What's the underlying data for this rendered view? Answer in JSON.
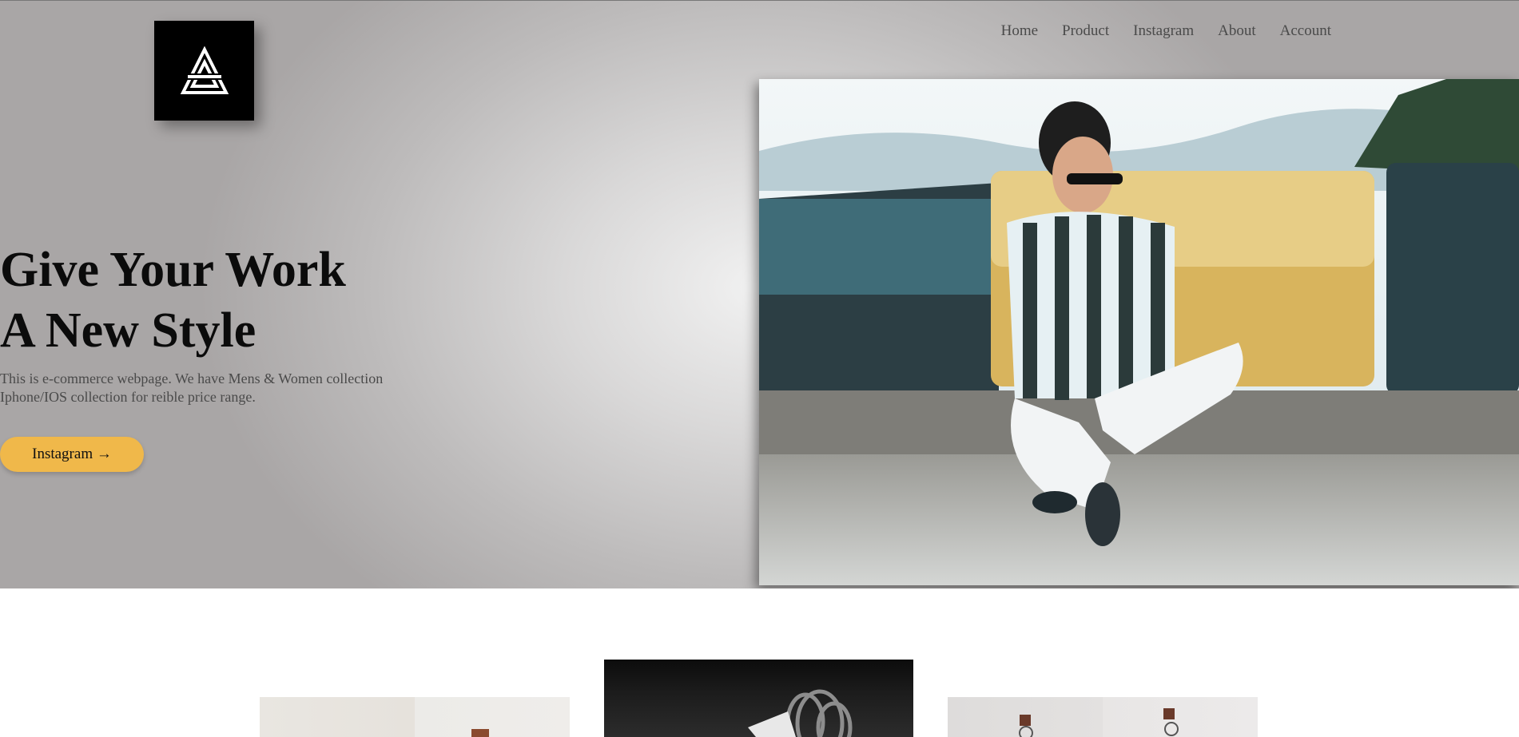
{
  "header": {
    "logo_icon": "triangle-a-logo-icon",
    "nav": [
      {
        "label": "Home"
      },
      {
        "label": "Product"
      },
      {
        "label": "Instagram"
      },
      {
        "label": "About"
      },
      {
        "label": "Account"
      }
    ]
  },
  "hero": {
    "headline_line1": "Give Your Work",
    "headline_line2": "A New Style",
    "description_line1": "This is e-commerce webpage. We have Mens & Women collection",
    "description_line2": "Iphone/IOS collection for reible price range.",
    "cta_label": "Instagram →",
    "cta_color": "#f0b84a"
  },
  "colors": {
    "nav_text": "#4a4a4a",
    "headline": "#0b0b0b",
    "description": "#4a4a4a"
  }
}
